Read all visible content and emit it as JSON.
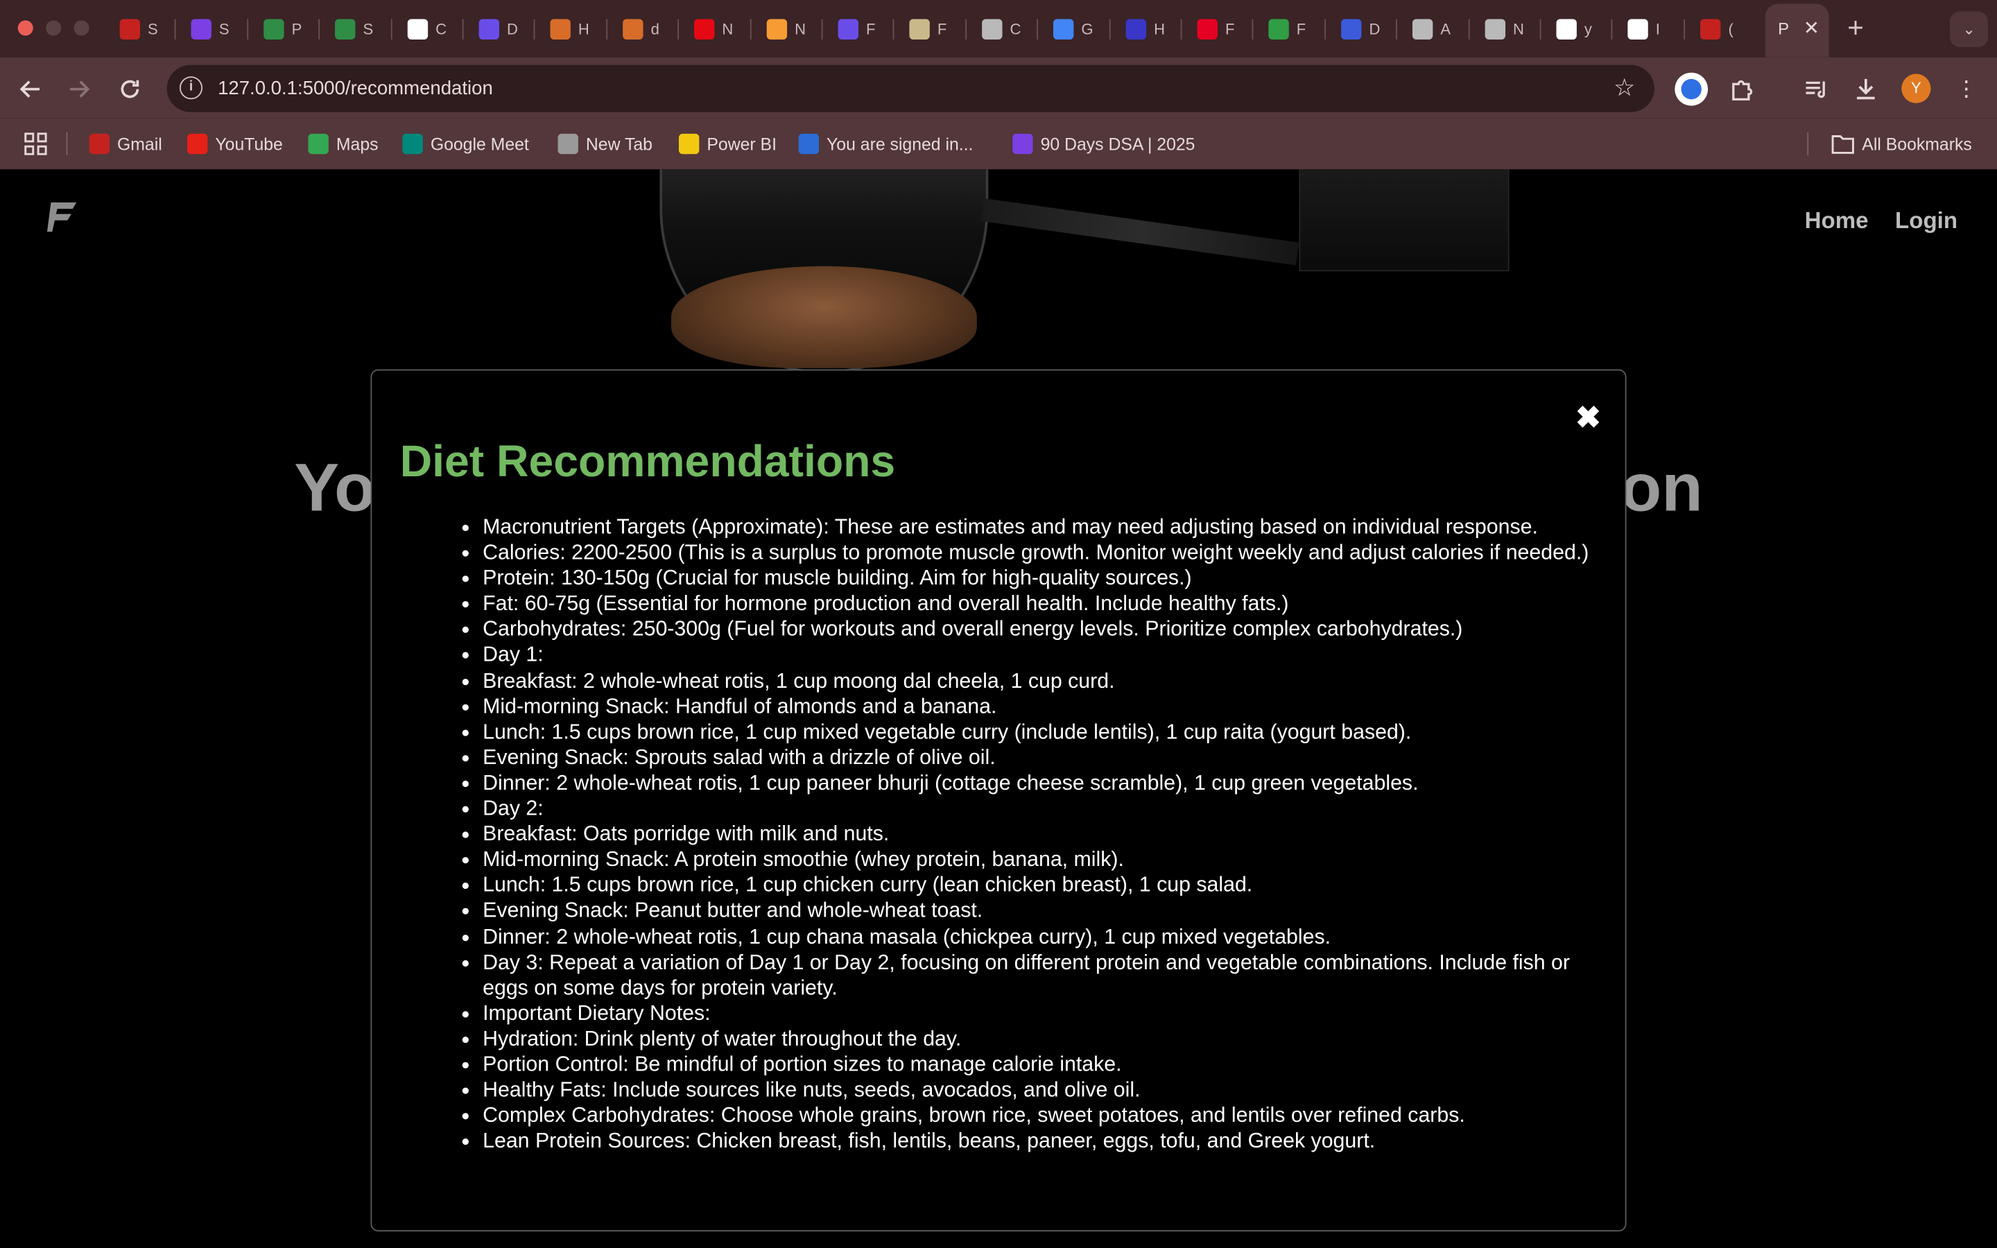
{
  "browser": {
    "tabs": [
      {
        "icon": "gmail-icon",
        "text": "S",
        "color": "#c5221f"
      },
      {
        "icon": "slides-icon",
        "text": "S",
        "color": "#7b3fe4"
      },
      {
        "icon": "gfg-icon",
        "text": "P",
        "color": "#2f8d46"
      },
      {
        "icon": "gfg-icon",
        "text": "S",
        "color": "#2f8d46"
      },
      {
        "icon": "openai-icon",
        "text": "C",
        "color": "#ffffff"
      },
      {
        "icon": "shield-icon",
        "text": "D",
        "color": "#6a4de8"
      },
      {
        "icon": "hackerrank-icon",
        "text": "H",
        "color": "#d86d2a"
      },
      {
        "icon": "doc-icon",
        "text": "d",
        "color": "#d86d2a"
      },
      {
        "icon": "netflix-icon",
        "text": "N",
        "color": "#e50914"
      },
      {
        "icon": "amazon-icon",
        "text": "N",
        "color": "#f79c34"
      },
      {
        "icon": "list-icon",
        "text": "F",
        "color": "#6a4de8"
      },
      {
        "icon": "card-icon",
        "text": "F",
        "color": "#c9b98a"
      },
      {
        "icon": "globe-icon",
        "text": "C",
        "color": "#b9b9b9"
      },
      {
        "icon": "google-icon",
        "text": "G",
        "color": "#4285f4"
      },
      {
        "icon": "d-icon",
        "text": "H",
        "color": "#3a36c8"
      },
      {
        "icon": "pinterest-icon",
        "text": "F",
        "color": "#e60023"
      },
      {
        "icon": "r-icon",
        "text": "F",
        "color": "#2f9e44"
      },
      {
        "icon": "devin-icon",
        "text": "D",
        "color": "#3b5bdb"
      },
      {
        "icon": "globe-icon",
        "text": "A",
        "color": "#b9b9b9"
      },
      {
        "icon": "chrome-icon",
        "text": "N",
        "color": "#b9b9b9"
      },
      {
        "icon": "github-icon",
        "text": "y",
        "color": "#ffffff"
      },
      {
        "icon": "github-icon",
        "text": "I",
        "color": "#ffffff"
      },
      {
        "icon": "gmail-icon",
        "text": "(",
        "color": "#c5221f"
      }
    ],
    "active_tab": {
      "text": "P",
      "close": "✕"
    },
    "new_tab": "+",
    "tab_menu": "⌄",
    "url": "127.0.0.1:5000/recommendation",
    "info": "i",
    "profile_initial": "Y",
    "bookmarks": [
      {
        "label": "Gmail",
        "icon": "gmail-icon",
        "color": "#c5221f"
      },
      {
        "label": "YouTube",
        "icon": "youtube-icon",
        "color": "#e62117"
      },
      {
        "label": "Maps",
        "icon": "maps-pin-icon",
        "color": "#34a853"
      },
      {
        "label": "Google Meet",
        "icon": "meet-icon",
        "color": "#00897b"
      },
      {
        "label": "New Tab",
        "icon": "globe-icon",
        "color": "#9a9a9a"
      },
      {
        "label": "Power BI",
        "icon": "powerbi-icon",
        "color": "#f2c811"
      },
      {
        "label": "You are signed in...",
        "icon": "s-icon",
        "color": "#2b6cd6"
      },
      {
        "label": "90 Days DSA | 2025",
        "icon": "monitor-icon",
        "color": "#7b3fe4"
      }
    ],
    "all_bookmarks": "All Bookmarks"
  },
  "site": {
    "nav": {
      "home": "Home",
      "login": "Login"
    },
    "hero_left": "Yo",
    "hero_right": "on"
  },
  "modal": {
    "close": "✖",
    "title": "Diet Recommendations",
    "items": [
      "Macronutrient Targets (Approximate): These are estimates and may need adjusting based on individual response.",
      "Calories: 2200-2500 (This is a surplus to promote muscle growth. Monitor weight weekly and adjust calories if needed.)",
      "Protein: 130-150g (Crucial for muscle building. Aim for high-quality sources.)",
      "Fat: 60-75g (Essential for hormone production and overall health. Include healthy fats.)",
      "Carbohydrates: 250-300g (Fuel for workouts and overall energy levels. Prioritize complex carbohydrates.)",
      "Day 1:",
      "Breakfast: 2 whole-wheat rotis, 1 cup moong dal cheela, 1 cup curd.",
      "Mid-morning Snack: Handful of almonds and a banana.",
      "Lunch: 1.5 cups brown rice, 1 cup mixed vegetable curry (include lentils), 1 cup raita (yogurt based).",
      "Evening Snack: Sprouts salad with a drizzle of olive oil.",
      "Dinner: 2 whole-wheat rotis, 1 cup paneer bhurji (cottage cheese scramble), 1 cup green vegetables.",
      "Day 2:",
      "Breakfast: Oats porridge with milk and nuts.",
      "Mid-morning Snack: A protein smoothie (whey protein, banana, milk).",
      "Lunch: 1.5 cups brown rice, 1 cup chicken curry (lean chicken breast), 1 cup salad.",
      "Evening Snack: Peanut butter and whole-wheat toast.",
      "Dinner: 2 whole-wheat rotis, 1 cup chana masala (chickpea curry), 1 cup mixed vegetables.",
      "Day 3: Repeat a variation of Day 1 or Day 2, focusing on different protein and vegetable combinations. Include fish or eggs on some days for protein variety.",
      "Important Dietary Notes:",
      "Hydration: Drink plenty of water throughout the day.",
      "Portion Control: Be mindful of portion sizes to manage calorie intake.",
      "Healthy Fats: Include sources like nuts, seeds, avocados, and olive oil.",
      "Complex Carbohydrates: Choose whole grains, brown rice, sweet potatoes, and lentils over refined carbs.",
      "Lean Protein Sources: Chicken breast, fish, lentils, beans, paneer, eggs, tofu, and Greek yogurt."
    ]
  }
}
